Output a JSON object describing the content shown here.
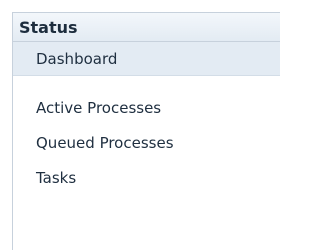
{
  "panel": {
    "title": "Status",
    "items": [
      {
        "label": "Dashboard",
        "selected": true
      },
      {
        "label": "Active Processes",
        "selected": false
      },
      {
        "label": "Queued Processes",
        "selected": false
      },
      {
        "label": "Tasks",
        "selected": false
      }
    ]
  },
  "colors": {
    "header_background": "#e3ebf3",
    "selected_background": "#e3ebf3",
    "border": "#c7d1dc",
    "text": "#1f2f40"
  }
}
